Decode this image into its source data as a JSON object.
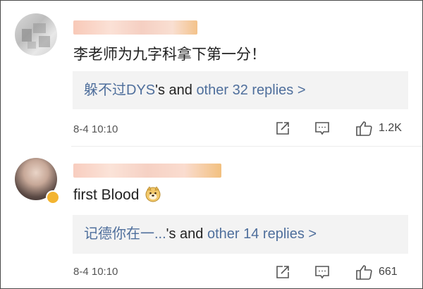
{
  "comments": [
    {
      "username": "",
      "text": "李老师为九字科拿下第一分！",
      "replies": {
        "lead": "躲不过DYS",
        "middle": "'s and ",
        "more": "other 32 replies >"
      },
      "time": "8-4 10:10",
      "likes": "1.2K",
      "icons": [
        "share-icon",
        "comment-icon",
        "like-icon"
      ]
    },
    {
      "username": "",
      "text": "first Blood",
      "emoji": "doge-emoji",
      "replies": {
        "lead": "记德你在一...",
        "middle": "'s and ",
        "more": "other 14 replies >"
      },
      "time": "8-4 10:10",
      "likes": "661",
      "icons": [
        "share-icon",
        "comment-icon",
        "like-icon"
      ]
    }
  ],
  "colors": {
    "link": "#4f6f9c",
    "text": "#222222",
    "meta": "#555555",
    "reply_bg": "#f3f3f3"
  }
}
